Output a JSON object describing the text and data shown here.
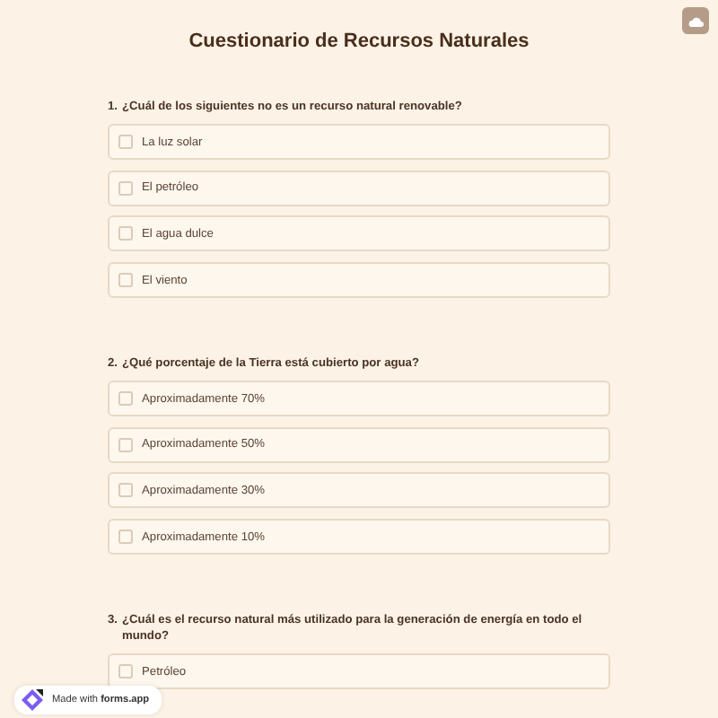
{
  "title": "Cuestionario de Recursos Naturales",
  "questions": [
    {
      "number": "1.",
      "text": "¿Cuál de los siguientes no es un recurso natural renovable?",
      "options": [
        {
          "label": "La luz solar",
          "checked": false
        },
        {
          "label": "El petróleo",
          "checked": false
        },
        {
          "label": "El agua dulce",
          "checked": false
        },
        {
          "label": "El viento",
          "checked": false
        }
      ]
    },
    {
      "number": "2.",
      "text": "¿Qué porcentaje de la Tierra está cubierto por agua?",
      "options": [
        {
          "label": "Aproximadamente 70%",
          "checked": false
        },
        {
          "label": "Aproximadamente 50%",
          "checked": false
        },
        {
          "label": "Aproximadamente 30%",
          "checked": false
        },
        {
          "label": "Aproximadamente 10%",
          "checked": false
        }
      ]
    },
    {
      "number": "3.",
      "text": "¿Cuál es el recurso natural más utilizado para la generación de energía en todo el mundo?",
      "options": [
        {
          "label": "Petróleo",
          "checked": false
        }
      ]
    }
  ],
  "badge": "Made with **forms.app**"
}
